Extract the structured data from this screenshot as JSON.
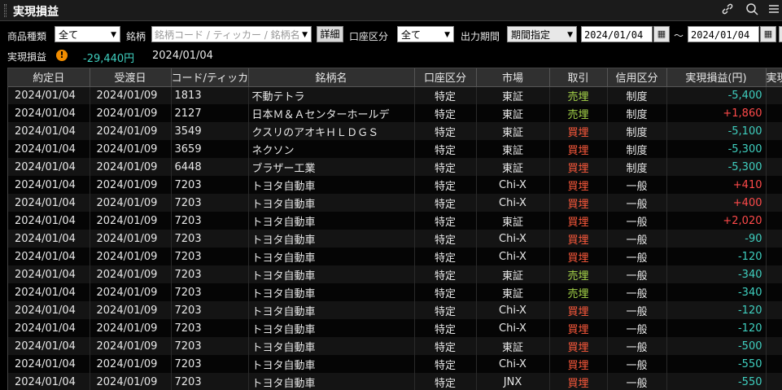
{
  "window": {
    "title": "実現損益"
  },
  "filters": {
    "product_label": "商品種類",
    "product_value": "全て",
    "symbol_label": "銘柄",
    "symbol_placeholder": "銘柄コード / ティッカー / 銘柄名",
    "detail_button": "詳細",
    "account_label": "口座区分",
    "account_value": "全て",
    "period_label": "出力期間",
    "period_value": "期間指定",
    "date_from": "2024/01/04",
    "tilde": "～",
    "date_to": "2024/01/04"
  },
  "summary": {
    "label": "実現損益",
    "warning_icon_text": "!",
    "value": "-29,440円",
    "date": "2024/01/04"
  },
  "columns": [
    "約定日",
    "受渡日",
    "コード/ティッカー",
    "銘柄名",
    "口座区分",
    "市場",
    "取引",
    "信用区分",
    "実現損益(円)",
    "実現損"
  ],
  "rows": [
    {
      "trade_date": "2024/01/04",
      "settle_date": "2024/01/09",
      "code": "1813",
      "name": "不動テトラ",
      "account": "特定",
      "market": "東証",
      "trade": "売埋",
      "trade_type": "sell",
      "margin": "制度",
      "pnl": "-5,400",
      "sign": "neg"
    },
    {
      "trade_date": "2024/01/04",
      "settle_date": "2024/01/09",
      "code": "2127",
      "name": "日本Ｍ＆Ａセンターホールデ",
      "account": "特定",
      "market": "東証",
      "trade": "売埋",
      "trade_type": "sell",
      "margin": "制度",
      "pnl": "+1,860",
      "sign": "pos"
    },
    {
      "trade_date": "2024/01/04",
      "settle_date": "2024/01/09",
      "code": "3549",
      "name": "クスリのアオキＨＬＤＧＳ",
      "account": "特定",
      "market": "東証",
      "trade": "買埋",
      "trade_type": "buy",
      "margin": "制度",
      "pnl": "-5,100",
      "sign": "neg"
    },
    {
      "trade_date": "2024/01/04",
      "settle_date": "2024/01/09",
      "code": "3659",
      "name": "ネクソン",
      "account": "特定",
      "market": "東証",
      "trade": "買埋",
      "trade_type": "buy",
      "margin": "制度",
      "pnl": "-5,300",
      "sign": "neg"
    },
    {
      "trade_date": "2024/01/04",
      "settle_date": "2024/01/09",
      "code": "6448",
      "name": "ブラザー工業",
      "account": "特定",
      "market": "東証",
      "trade": "買埋",
      "trade_type": "buy",
      "margin": "制度",
      "pnl": "-5,300",
      "sign": "neg"
    },
    {
      "trade_date": "2024/01/04",
      "settle_date": "2024/01/09",
      "code": "7203",
      "name": "トヨタ自動車",
      "account": "特定",
      "market": "Chi-X",
      "trade": "買埋",
      "trade_type": "buy",
      "margin": "一般",
      "pnl": "+410",
      "sign": "pos"
    },
    {
      "trade_date": "2024/01/04",
      "settle_date": "2024/01/09",
      "code": "7203",
      "name": "トヨタ自動車",
      "account": "特定",
      "market": "Chi-X",
      "trade": "買埋",
      "trade_type": "buy",
      "margin": "一般",
      "pnl": "+400",
      "sign": "pos"
    },
    {
      "trade_date": "2024/01/04",
      "settle_date": "2024/01/09",
      "code": "7203",
      "name": "トヨタ自動車",
      "account": "特定",
      "market": "東証",
      "trade": "買埋",
      "trade_type": "buy",
      "margin": "一般",
      "pnl": "+2,020",
      "sign": "pos"
    },
    {
      "trade_date": "2024/01/04",
      "settle_date": "2024/01/09",
      "code": "7203",
      "name": "トヨタ自動車",
      "account": "特定",
      "market": "Chi-X",
      "trade": "買埋",
      "trade_type": "buy",
      "margin": "一般",
      "pnl": "-90",
      "sign": "neg"
    },
    {
      "trade_date": "2024/01/04",
      "settle_date": "2024/01/09",
      "code": "7203",
      "name": "トヨタ自動車",
      "account": "特定",
      "market": "Chi-X",
      "trade": "買埋",
      "trade_type": "buy",
      "margin": "一般",
      "pnl": "-120",
      "sign": "neg"
    },
    {
      "trade_date": "2024/01/04",
      "settle_date": "2024/01/09",
      "code": "7203",
      "name": "トヨタ自動車",
      "account": "特定",
      "market": "東証",
      "trade": "売埋",
      "trade_type": "sell",
      "margin": "一般",
      "pnl": "-340",
      "sign": "neg"
    },
    {
      "trade_date": "2024/01/04",
      "settle_date": "2024/01/09",
      "code": "7203",
      "name": "トヨタ自動車",
      "account": "特定",
      "market": "東証",
      "trade": "売埋",
      "trade_type": "sell",
      "margin": "一般",
      "pnl": "-340",
      "sign": "neg"
    },
    {
      "trade_date": "2024/01/04",
      "settle_date": "2024/01/09",
      "code": "7203",
      "name": "トヨタ自動車",
      "account": "特定",
      "market": "Chi-X",
      "trade": "買埋",
      "trade_type": "buy",
      "margin": "一般",
      "pnl": "-120",
      "sign": "neg"
    },
    {
      "trade_date": "2024/01/04",
      "settle_date": "2024/01/09",
      "code": "7203",
      "name": "トヨタ自動車",
      "account": "特定",
      "market": "Chi-X",
      "trade": "買埋",
      "trade_type": "buy",
      "margin": "一般",
      "pnl": "-120",
      "sign": "neg"
    },
    {
      "trade_date": "2024/01/04",
      "settle_date": "2024/01/09",
      "code": "7203",
      "name": "トヨタ自動車",
      "account": "特定",
      "market": "東証",
      "trade": "買埋",
      "trade_type": "buy",
      "margin": "一般",
      "pnl": "-500",
      "sign": "neg"
    },
    {
      "trade_date": "2024/01/04",
      "settle_date": "2024/01/09",
      "code": "7203",
      "name": "トヨタ自動車",
      "account": "特定",
      "market": "Chi-X",
      "trade": "買埋",
      "trade_type": "buy",
      "margin": "一般",
      "pnl": "-550",
      "sign": "neg"
    },
    {
      "trade_date": "2024/01/04",
      "settle_date": "2024/01/09",
      "code": "7203",
      "name": "トヨタ自動車",
      "account": "特定",
      "market": "JNX",
      "trade": "買埋",
      "trade_type": "buy",
      "margin": "一般",
      "pnl": "-550",
      "sign": "neg"
    }
  ],
  "colors": {
    "background": "#000000",
    "sell": "#a8d84a",
    "buy": "#ff5a3c",
    "profit": "#ff4a4a",
    "loss": "#3fd0c0",
    "warning": "#f08c00"
  },
  "icons": [
    "link-icon",
    "search-icon",
    "menu-icon",
    "warning-icon",
    "calendar-icon",
    "chevron-down-icon"
  ]
}
